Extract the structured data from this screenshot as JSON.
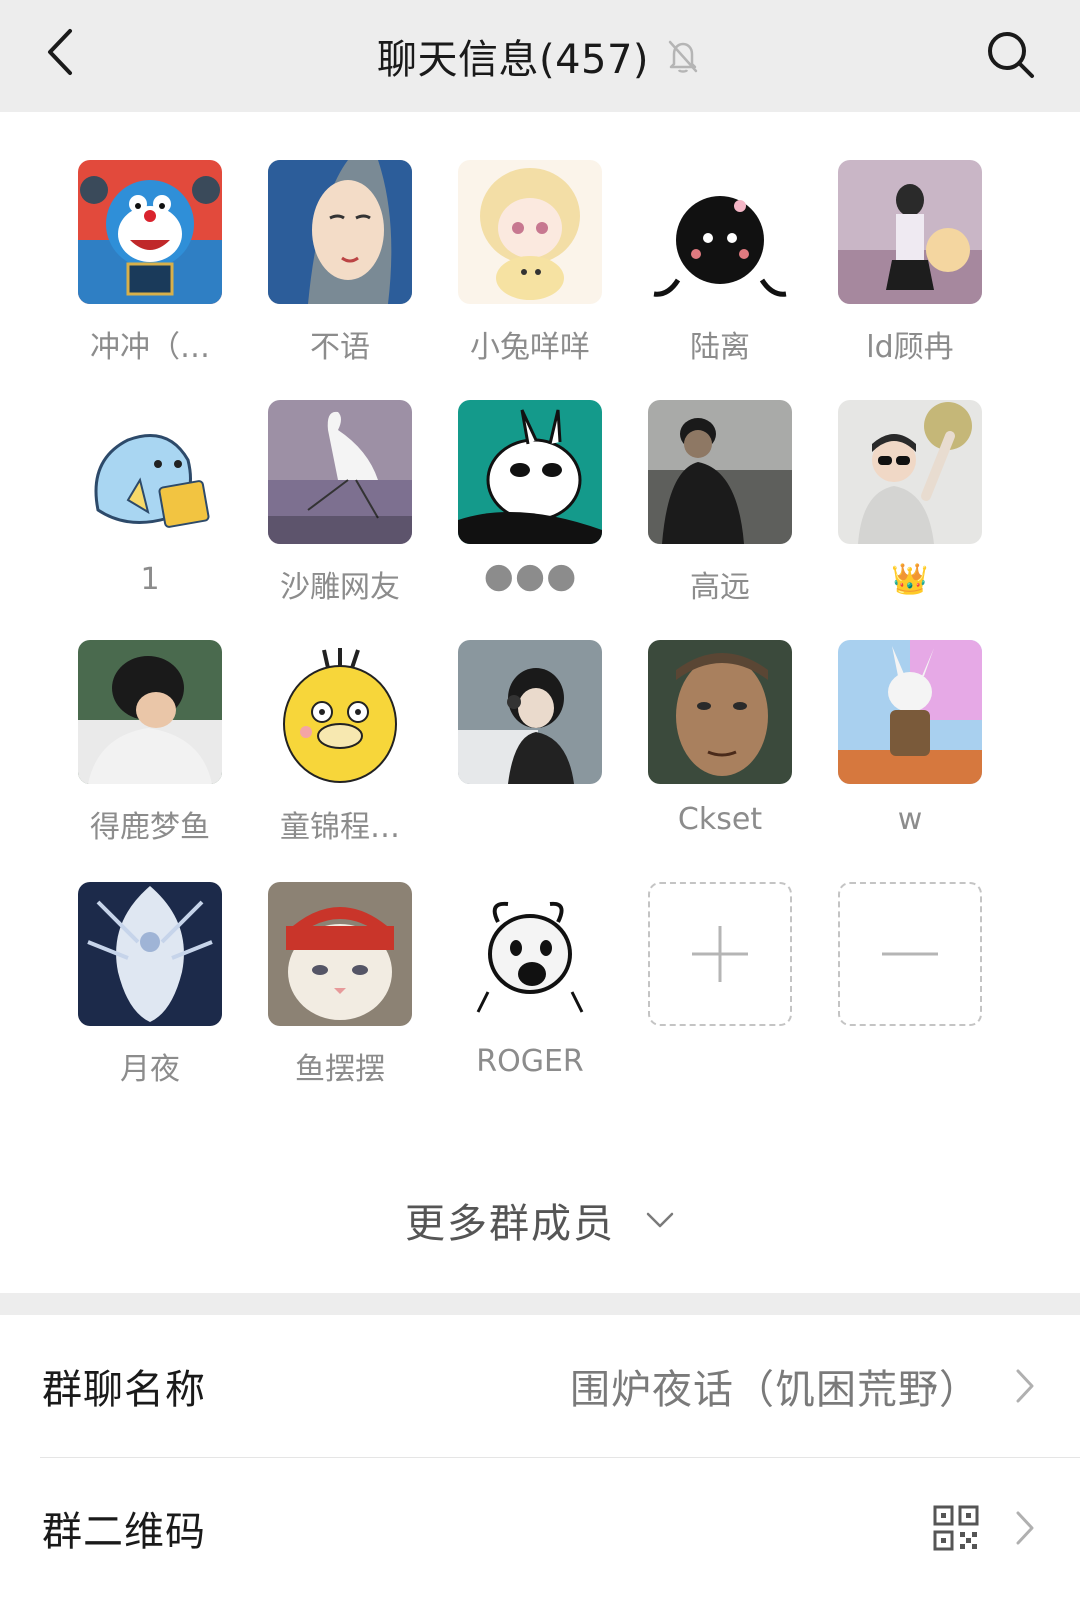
{
  "header": {
    "title": "聊天信息(457)",
    "back_icon": "chevron-left-icon",
    "mute_icon": "bell-off-icon",
    "search_icon": "search-icon"
  },
  "members": [
    {
      "name": "冲冲（…",
      "avatar": "doraemon-avatar",
      "color": "#2f7fc4"
    },
    {
      "name": "不语",
      "avatar": "blue-hair-girl-avatar",
      "color": "#3a6fa8"
    },
    {
      "name": "小兔咩咩",
      "avatar": "anime-girl-avatar",
      "color": "#f4e3c0"
    },
    {
      "name": "陆离",
      "avatar": "black-fuzzball-avatar",
      "color": "#111111"
    },
    {
      "name": "ld顾冉",
      "avatar": "girl-sunset-avatar",
      "color": "#b59fb4"
    },
    {
      "name": "1",
      "avatar": "blue-dolphin-chips-avatar",
      "color": "#9fd0f0"
    },
    {
      "name": "沙雕网友",
      "avatar": "egret-avatar",
      "color": "#8f8899"
    },
    {
      "name": "🌑🌑🌑",
      "avatar": "cartoon-rabbit-teal-avatar",
      "color": "#1a9c8c"
    },
    {
      "name": "高远",
      "avatar": "man-seaside-avatar",
      "color": "#555a5e"
    },
    {
      "name": "👑",
      "avatar": "child-sunglasses-avatar",
      "color": "#d9d9d9"
    },
    {
      "name": "得鹿梦鱼",
      "avatar": "boy-helmet-avatar",
      "color": "#4a6a4e"
    },
    {
      "name": "童锦程…",
      "avatar": "psyduck-avatar",
      "color": "#f7d63a"
    },
    {
      "name": "",
      "avatar": "girl-headphones-avatar",
      "color": "#7a8a92"
    },
    {
      "name": "Ckset",
      "avatar": "man-face-avatar",
      "color": "#6e5a44"
    },
    {
      "name": "w",
      "avatar": "rabbit-soldier-avatar",
      "color": "#d1a6e0"
    },
    {
      "name": "月夜",
      "avatar": "white-dragon-avatar",
      "color": "#1c2a4a"
    },
    {
      "name": "鱼摆摆",
      "avatar": "cat-bandana-avatar",
      "color": "#c9352a"
    },
    {
      "name": "ROGER",
      "avatar": "sketch-dog-avatar",
      "color": "#f4f4f4"
    }
  ],
  "add_button": {
    "icon": "plus-icon"
  },
  "remove_button": {
    "icon": "minus-icon"
  },
  "more_members": {
    "label": "更多群成员",
    "icon": "chevron-down-icon"
  },
  "settings": {
    "group_name": {
      "label": "群聊名称",
      "value": "围炉夜话（饥困荒野）",
      "icon": "chevron-right-icon"
    },
    "group_qr": {
      "label": "群二维码",
      "icon": "qr-code-icon"
    }
  }
}
